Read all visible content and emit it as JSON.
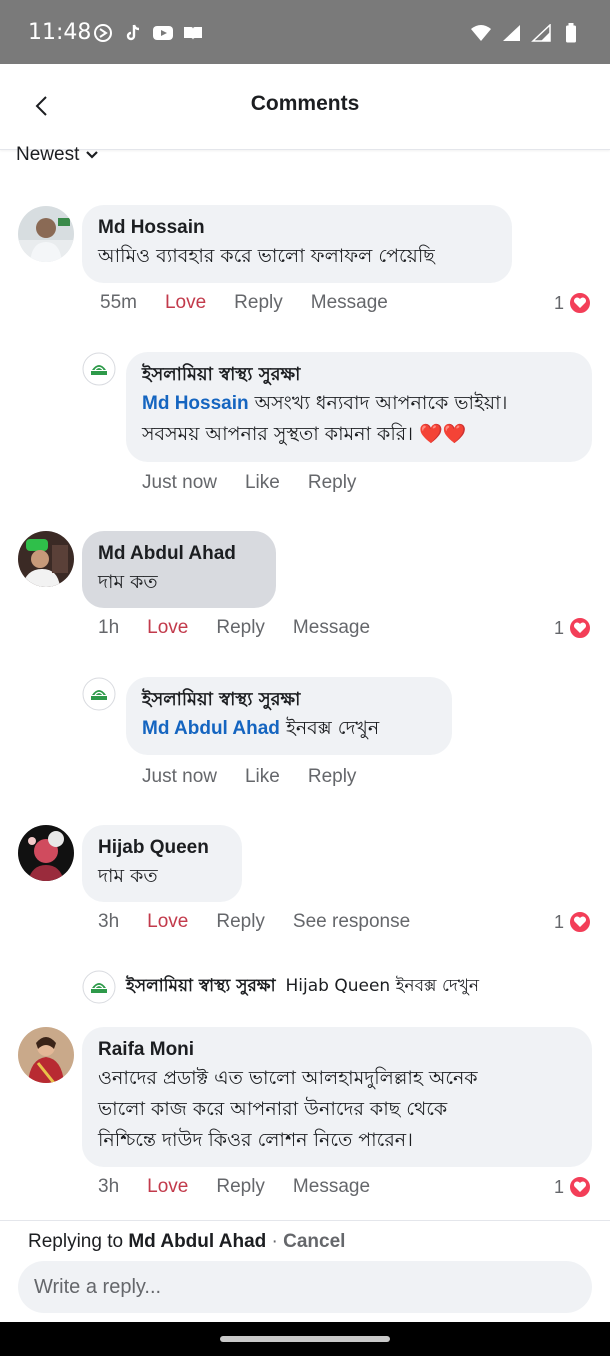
{
  "status_bar": {
    "time": "11:48",
    "left_icons": [
      "sync-icon",
      "tiktok-icon",
      "youtube-icon",
      "book-icon"
    ],
    "right_icons": [
      "wifi-icon",
      "signal-icon",
      "signal-icon",
      "battery-icon"
    ]
  },
  "header": {
    "title": "Comments",
    "back_icon": "chevron-left-icon"
  },
  "sort": {
    "label": "Newest"
  },
  "comments": [
    {
      "author": "Md Hossain",
      "text": "আমিও ব্যাবহার করে ভালো ফলাফল পেয়েছি",
      "time": "55m",
      "love": "Love",
      "reply": "Reply",
      "third": "Message",
      "reaction_count": "1",
      "reply_item": {
        "author": "ইসলামিয়া স্বাস্থ্য সুরক্ষা",
        "mention": "Md Hossain",
        "line1": " অসংখ্য ধন্যবাদ আপনাকে ভাইয়া।",
        "line2": "সবসময় আপনার সুস্থতা কামনা করি। ❤️❤️",
        "time": "Just now",
        "like": "Like",
        "reply": "Reply"
      }
    },
    {
      "author": "Md Abdul Ahad",
      "text": "দাম কত",
      "time": "1h",
      "love": "Love",
      "reply": "Reply",
      "third": "Message",
      "reaction_count": "1",
      "reply_item": {
        "author": "ইসলামিয়া স্বাস্থ্য সুরক্ষা",
        "mention": "Md Abdul Ahad",
        "line1": " ইনবক্স দেখুন",
        "time": "Just now",
        "like": "Like",
        "reply": "Reply"
      }
    },
    {
      "author": "Hijab Queen",
      "text": "দাম কত",
      "time": "3h",
      "love": "Love",
      "reply": "Reply",
      "third": "See response",
      "reaction_count": "1",
      "collapsed_reply": {
        "author": "ইসলামিয়া স্বাস্থ্য সুরক্ষা",
        "text": "Hijab Queen ইনবক্স দেখুন"
      }
    },
    {
      "author": "Raifa Moni",
      "line1": "ওনাদের প্রডাক্ট এত ভালো আলহামদুলিল্লাহ অনেক",
      "line2": "ভালো কাজ করে আপনারা উনাদের কাছ থেকে",
      "line3": "নিশ্চিন্তে দাউদ কিওর লোশন নিতে পারেন।",
      "time": "3h",
      "love": "Love",
      "reply": "Reply",
      "third": "Message",
      "reaction_count": "1"
    }
  ],
  "reply_bar": {
    "replying_prefix": "Replying to ",
    "replying_name": "Md Abdul Ahad",
    "separator": " · ",
    "cancel": "Cancel",
    "placeholder": "Write a reply..."
  },
  "colors": {
    "love": "#c23a4b",
    "mention": "#1565c0",
    "bubble": "#f0f2f5",
    "reaction": "#f33e58"
  }
}
